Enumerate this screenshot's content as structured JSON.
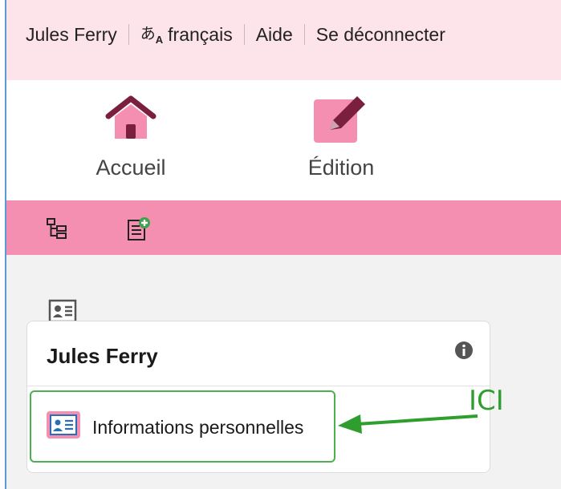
{
  "header": {
    "user_name": "Jules Ferry",
    "language_glyph": "あ",
    "language_glyph_sub": "A",
    "language_label": "français",
    "help_label": "Aide",
    "logout_label": "Se déconnecter"
  },
  "nav": {
    "home_label": "Accueil",
    "edit_label": "Édition"
  },
  "card": {
    "title": "Jules Ferry",
    "link_label": "Informations personnelles"
  },
  "annotation": {
    "text": "ICI"
  },
  "colors": {
    "accent_pink": "#f48fb1",
    "header_bg": "#fde3ea",
    "icon_dark": "#7a1f3d",
    "annotation_green": "#4caf50"
  },
  "icons": [
    "home-icon",
    "edit-icon",
    "tree-view-icon",
    "add-document-icon",
    "contact-card-icon",
    "info-icon",
    "arrow-annotation"
  ]
}
